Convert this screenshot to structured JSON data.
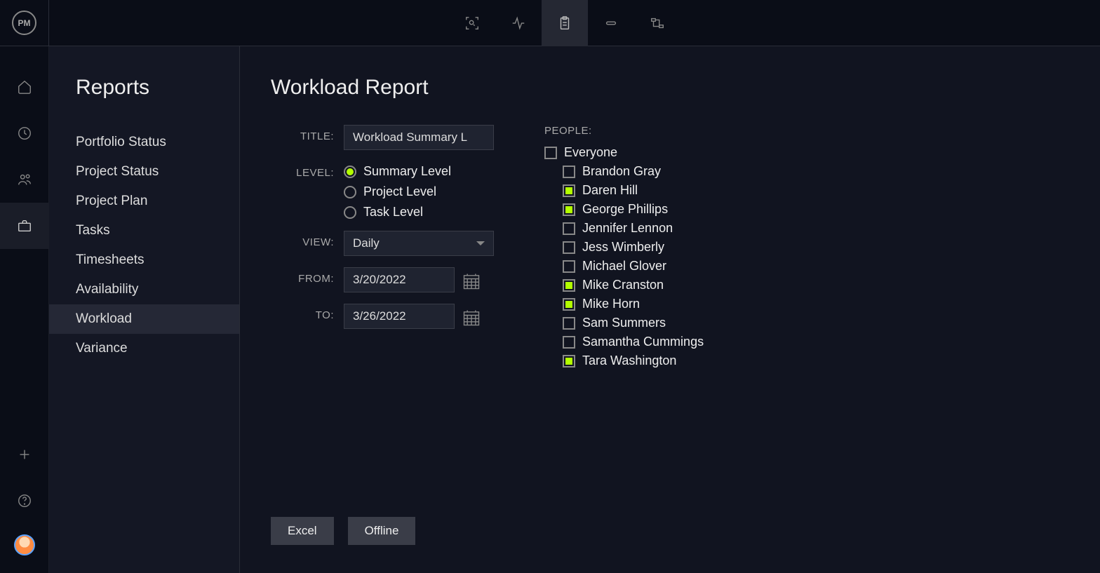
{
  "logo": "PM",
  "sidebar": {
    "title": "Reports",
    "items": [
      {
        "label": "Portfolio Status",
        "active": false
      },
      {
        "label": "Project Status",
        "active": false
      },
      {
        "label": "Project Plan",
        "active": false
      },
      {
        "label": "Tasks",
        "active": false
      },
      {
        "label": "Timesheets",
        "active": false
      },
      {
        "label": "Availability",
        "active": false
      },
      {
        "label": "Workload",
        "active": true
      },
      {
        "label": "Variance",
        "active": false
      }
    ]
  },
  "page": {
    "title": "Workload Report",
    "labels": {
      "title": "TITLE:",
      "level": "LEVEL:",
      "view": "VIEW:",
      "from": "FROM:",
      "to": "TO:",
      "people": "PEOPLE:"
    },
    "form": {
      "title_value": "Workload Summary L",
      "levels": [
        {
          "label": "Summary Level",
          "checked": true
        },
        {
          "label": "Project Level",
          "checked": false
        },
        {
          "label": "Task Level",
          "checked": false
        }
      ],
      "view_value": "Daily",
      "from_value": "3/20/2022",
      "to_value": "3/26/2022"
    },
    "people": {
      "all_label": "Everyone",
      "all_checked": false,
      "items": [
        {
          "label": "Brandon Gray",
          "checked": false
        },
        {
          "label": "Daren Hill",
          "checked": true
        },
        {
          "label": "George Phillips",
          "checked": true
        },
        {
          "label": "Jennifer Lennon",
          "checked": false
        },
        {
          "label": "Jess Wimberly",
          "checked": false
        },
        {
          "label": "Michael Glover",
          "checked": false
        },
        {
          "label": "Mike Cranston",
          "checked": true
        },
        {
          "label": "Mike Horn",
          "checked": true
        },
        {
          "label": "Sam Summers",
          "checked": false
        },
        {
          "label": "Samantha Cummings",
          "checked": false
        },
        {
          "label": "Tara Washington",
          "checked": true
        }
      ]
    },
    "buttons": {
      "excel": "Excel",
      "offline": "Offline"
    }
  }
}
